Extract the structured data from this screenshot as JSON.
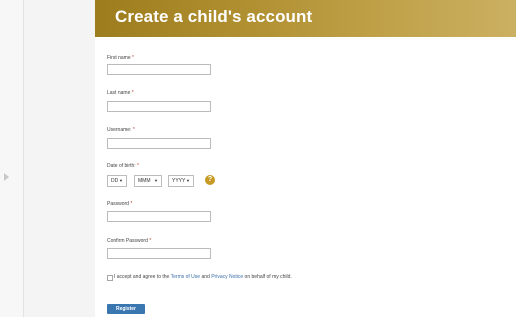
{
  "header": {
    "title": "Create a child's account"
  },
  "form": {
    "first_name_label": "First name",
    "last_name_label": "Last name",
    "username_label": "Username:",
    "dob_label": "Date of birth:",
    "password_label": "Password",
    "confirm_password_label": "Confirm Password",
    "required_marker": "*",
    "dob": {
      "day": "DD",
      "month": "MMM",
      "year": "YYYY",
      "help_glyph": "?"
    },
    "terms": {
      "prefix": "I accept and agree to the ",
      "terms_link": "Terms of Use",
      "middle": " and ",
      "privacy_link": "Privacy Notice",
      "suffix": " on behalf of my child."
    },
    "register_label": "Register"
  },
  "colors": {
    "header_gold": "#b08f30",
    "button_blue": "#3a76b0",
    "help_icon_gold": "#c79a23",
    "required_red": "#c0392b"
  },
  "icons": {
    "help": "question-circle-icon",
    "dropdown": "chevron-down-icon",
    "rail_arrow": "triangle-right-icon"
  }
}
